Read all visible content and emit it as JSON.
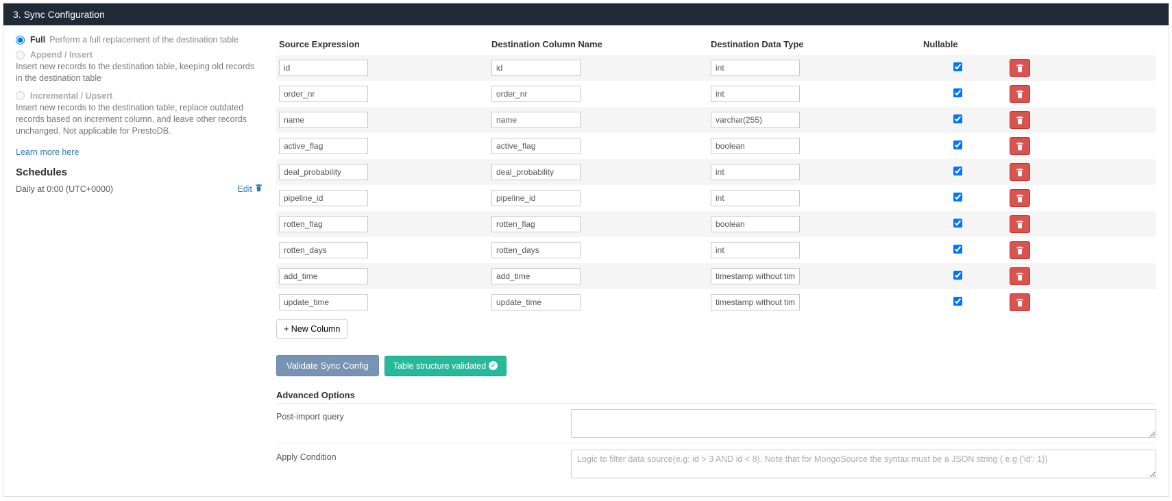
{
  "header": {
    "title": "3. Sync Configuration"
  },
  "sidebar": {
    "modes": [
      {
        "key": "full",
        "label": "Full",
        "desc_inline": "Perform a full replacement of the destination table",
        "desc_below": "",
        "enabled": true,
        "selected": true
      },
      {
        "key": "append",
        "label": "Append / Insert",
        "desc_inline": "",
        "desc_below": "Insert new records to the destination table, keeping old records in the destination table",
        "enabled": false,
        "selected": false
      },
      {
        "key": "incremental",
        "label": "Incremental / Upsert",
        "desc_inline": "",
        "desc_below": "Insert new records to the destination table, replace outdated records based on increment column, and leave other records unchanged. Not applicable for PrestoDB.",
        "enabled": false,
        "selected": false
      }
    ],
    "learn_more": "Learn more here",
    "schedules_title": "Schedules",
    "schedule_text": "Daily at 0:00 (UTC+0000)",
    "edit_label": "Edit"
  },
  "table": {
    "headers": {
      "source": "Source Expression",
      "dest": "Destination Column Name",
      "type": "Destination Data Type",
      "nullable": "Nullable"
    },
    "rows": [
      {
        "source": "id",
        "dest": "id",
        "type": "int",
        "nullable": true
      },
      {
        "source": "order_nr",
        "dest": "order_nr",
        "type": "int",
        "nullable": true
      },
      {
        "source": "name",
        "dest": "name",
        "type": "varchar(255)",
        "nullable": true
      },
      {
        "source": "active_flag",
        "dest": "active_flag",
        "type": "boolean",
        "nullable": true
      },
      {
        "source": "deal_probability",
        "dest": "deal_probability",
        "type": "int",
        "nullable": true
      },
      {
        "source": "pipeline_id",
        "dest": "pipeline_id",
        "type": "int",
        "nullable": true
      },
      {
        "source": "rotten_flag",
        "dest": "rotten_flag",
        "type": "boolean",
        "nullable": true
      },
      {
        "source": "rotten_days",
        "dest": "rotten_days",
        "type": "int",
        "nullable": true
      },
      {
        "source": "add_time",
        "dest": "add_time",
        "type": "timestamp without time zone",
        "nullable": true
      },
      {
        "source": "update_time",
        "dest": "update_time",
        "type": "timestamp without time zone",
        "nullable": true
      }
    ],
    "new_column": "+ New Column"
  },
  "buttons": {
    "validate": "Validate Sync Config",
    "validated": "Table structure validated"
  },
  "advanced": {
    "title": "Advanced Options",
    "rows": [
      {
        "label": "Post-import query",
        "placeholder": ""
      },
      {
        "label": "Apply Condition",
        "placeholder": "Logic to filter data source(e.g: id > 3 AND id < 8). Note that for MongoSource the syntax must be a JSON string ( e.g {'id': 1})"
      }
    ]
  }
}
